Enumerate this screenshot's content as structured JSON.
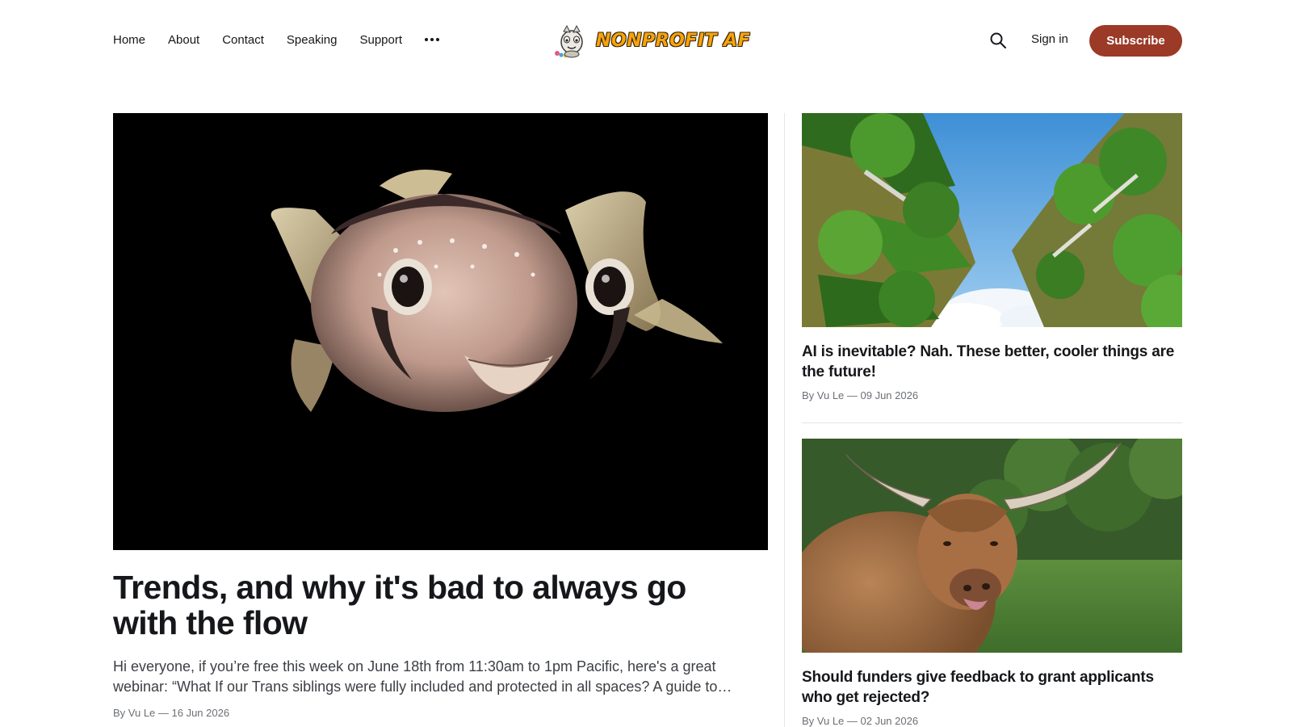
{
  "nav": {
    "items": [
      {
        "label": "Home"
      },
      {
        "label": "About"
      },
      {
        "label": "Contact"
      },
      {
        "label": "Speaking"
      },
      {
        "label": "Support"
      }
    ],
    "more_icon": "ellipsis-icon"
  },
  "logo": {
    "text": "NONPROFIT AF",
    "mascot_icon": "mascot-logo-icon",
    "color": "#f5a30f"
  },
  "header_actions": {
    "search_icon": "search-icon",
    "signin_label": "Sign in",
    "subscribe_label": "Subscribe",
    "accent_color": "#9b3a27"
  },
  "feature": {
    "image": "pufferfish photo on black background",
    "title": "Trends, and why it's bad to always go with the flow",
    "excerpt": "Hi everyone, if you’re free this week on June 18th from 11:30am to 1pm Pacific, here's a great webinar: “What If our Trans siblings were fully included and protected in all spaces? A guide to creating inclusive spaces for trans people”",
    "byline": "By Vu Le — 16 Jun 2026"
  },
  "side_posts": [
    {
      "image": "vertical forest buildings with blue sky",
      "title": "AI is inevitable? Nah. These better, cooler things are the future!",
      "byline": "By Vu Le — 09 Jun 2026"
    },
    {
      "image": "highland cow in a green field",
      "title": "Should funders give feedback to grant applicants who get rejected?",
      "byline": "By Vu Le — 02 Jun 2026"
    }
  ]
}
